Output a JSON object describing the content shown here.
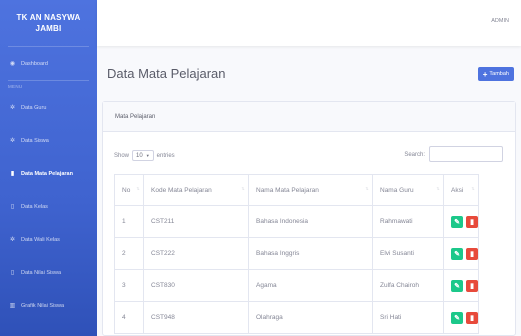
{
  "brand": {
    "line1": "TK AN NASYWA",
    "line2": "JAMBI"
  },
  "sidebar": {
    "dashboard": "Dashboard",
    "heading": "MENU",
    "items": [
      {
        "label": "Data Guru",
        "icon": "users-icon"
      },
      {
        "label": "Data Siswa",
        "icon": "users-icon"
      },
      {
        "label": "Data Mata Pelajaran",
        "icon": "book-icon",
        "active": true
      },
      {
        "label": "Data Kelas",
        "icon": "file-icon"
      },
      {
        "label": "Data Wali Kelas",
        "icon": "users-icon"
      },
      {
        "label": "Data Nilai Siswa",
        "icon": "file-icon"
      },
      {
        "label": "Grafik Nilai Siswa",
        "icon": "chart-icon"
      }
    ]
  },
  "topbar": {
    "user": "ADMIN"
  },
  "page": {
    "title": "Data Mata Pelajaran",
    "add_label": "Tambah"
  },
  "card": {
    "title": "Mata Pelajaran"
  },
  "controls": {
    "show": "Show",
    "entries_value": "10",
    "entries": "entries",
    "search_label": "Search:"
  },
  "table": {
    "headers": [
      "No",
      "Kode Mata Pelajaran",
      "Nama Mata Pelajaran",
      "Nama Guru",
      "Aksi"
    ],
    "rows": [
      [
        "1",
        "CST211",
        "Bahasa Indonesia",
        "Rahmawati"
      ],
      [
        "2",
        "CST222",
        "Bahasa Inggris",
        "Elvi Susanti"
      ],
      [
        "3",
        "CST830",
        "Agama",
        "Zulfa Chairoh"
      ],
      [
        "4",
        "CST948",
        "Olahraga",
        "Sri Hati"
      ]
    ]
  },
  "colors": {
    "primary": "#4e73df",
    "success": "#1cc88a",
    "danger": "#e74a3b"
  }
}
